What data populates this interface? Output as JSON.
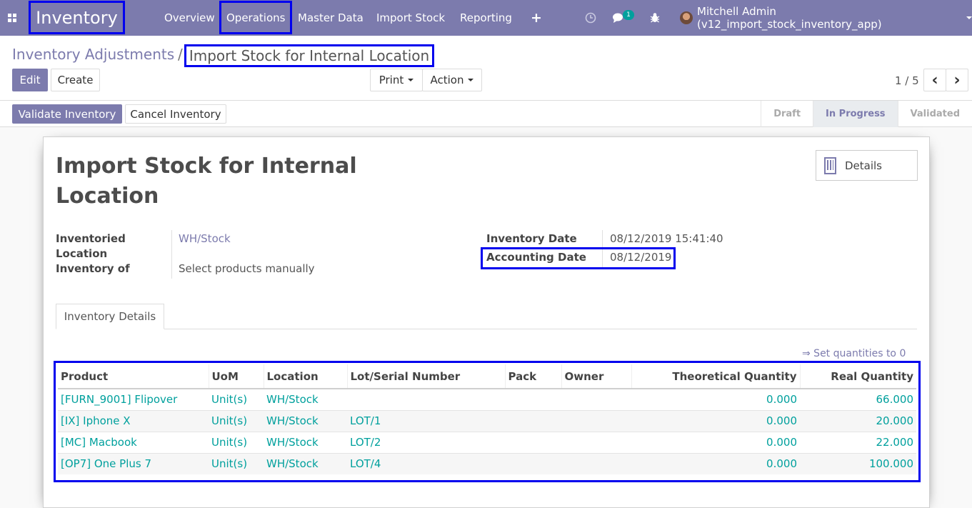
{
  "navbar": {
    "app_name": "Inventory",
    "menus": [
      "Overview",
      "Operations",
      "Master Data",
      "Import Stock",
      "Reporting"
    ],
    "add_icon": "+",
    "chat_count": "1",
    "user": "Mitchell Admin (v12_import_stock_inventory_app)"
  },
  "breadcrumb": {
    "parent": "Inventory Adjustments",
    "separator": "/",
    "current": "Import Stock for Internal Location"
  },
  "toolbar": {
    "edit": "Edit",
    "create": "Create",
    "print": "Print",
    "action": "Action",
    "pager": "1 / 5",
    "prev_icon": "‹",
    "next_icon": "›"
  },
  "statusbar": {
    "validate": "Validate Inventory",
    "cancel": "Cancel Inventory",
    "stages": [
      "Draft",
      "In Progress",
      "Validated"
    ],
    "active_stage": "In Progress"
  },
  "form": {
    "title_line1": "Import Stock for Internal",
    "title_line2": "Location",
    "details_button": "Details",
    "inventoried_location_label_1": "Inventoried",
    "inventoried_location_label_2": "Location",
    "inventoried_location": "WH/Stock",
    "inventory_of_label": "Inventory of",
    "inventory_of": "Select products manually",
    "inventory_date_label": "Inventory Date",
    "inventory_date": "08/12/2019 15:41:40",
    "accounting_date_label": "Accounting Date",
    "accounting_date": "08/12/2019",
    "tab_label": "Inventory Details",
    "set_quantities": "⇒ Set quantities to 0"
  },
  "table": {
    "headers": [
      "Product",
      "UoM",
      "Location",
      "Lot/Serial Number",
      "Pack",
      "Owner",
      "Theoretical Quantity",
      "Real Quantity"
    ],
    "rows": [
      [
        "[FURN_9001] Flipover",
        "Unit(s)",
        "WH/Stock",
        "",
        "",
        "",
        "0.000",
        "66.000"
      ],
      [
        "[IX] Iphone X",
        "Unit(s)",
        "WH/Stock",
        "LOT/1",
        "",
        "",
        "0.000",
        "20.000"
      ],
      [
        "[MC] Macbook",
        "Unit(s)",
        "WH/Stock",
        "LOT/2",
        "",
        "",
        "0.000",
        "22.000"
      ],
      [
        "[OP7] One Plus 7",
        "Unit(s)",
        "WH/Stock",
        "LOT/4",
        "",
        "",
        "0.000",
        "100.000"
      ]
    ]
  },
  "colors": {
    "brand": "#7c7bad",
    "link": "#00a09d",
    "highlight_box": "#0000ee"
  }
}
